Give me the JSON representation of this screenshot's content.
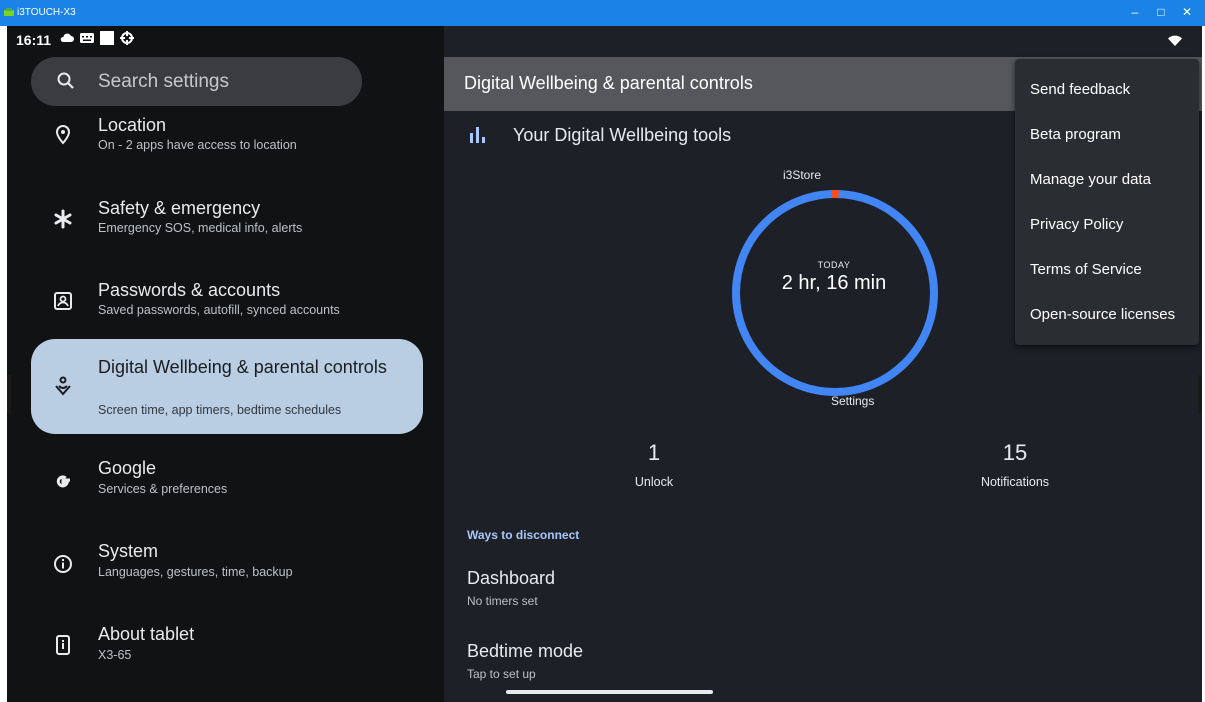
{
  "window": {
    "title": "i3TOUCH-X3",
    "minimize": "–",
    "maximize": "□",
    "close": "✕"
  },
  "status_bar": {
    "time": "16:11",
    "icons": [
      "cloud-icon",
      "keyboard-icon",
      "square-icon",
      "gear-icon"
    ],
    "right_icon": "wifi-icon"
  },
  "search": {
    "placeholder": "Search settings",
    "icon": "search-icon"
  },
  "sidebar": {
    "items": [
      {
        "title": "Location",
        "subtitle": "On - 2 apps have access to location",
        "icon": "location-pin-icon"
      },
      {
        "title": "Safety & emergency",
        "subtitle": "Emergency SOS, medical info, alerts",
        "icon": "asterisk-icon"
      },
      {
        "title": "Passwords & accounts",
        "subtitle": "Saved passwords, autofill, synced accounts",
        "icon": "account-box-icon"
      },
      {
        "title": "Digital Wellbeing & parental controls",
        "subtitle": "Screen time, app timers, bedtime schedules",
        "icon": "wellbeing-icon",
        "selected": true
      },
      {
        "title": "Google",
        "subtitle": "Services & preferences",
        "icon": "google-icon"
      },
      {
        "title": "System",
        "subtitle": "Languages, gestures, time, backup",
        "icon": "info-icon"
      },
      {
        "title": "About tablet",
        "subtitle": "X3-65",
        "icon": "tablet-icon"
      }
    ]
  },
  "main": {
    "header_title": "Digital Wellbeing & parental controls",
    "tools_title": "Your Digital Wellbeing tools",
    "ring": {
      "top_label": "i3Store",
      "bottom_label": "Settings",
      "period": "TODAY",
      "total_time": "2 hr, 16 min",
      "color_main": "#4285f4",
      "color_accent": "#f4511e",
      "accent_fraction": 0.012
    },
    "stats": [
      {
        "value": "1",
        "label": "Unlock"
      },
      {
        "value": "15",
        "label": "Notifications"
      }
    ],
    "section_title": "Ways to disconnect",
    "rows": [
      {
        "title": "Dashboard",
        "subtitle": "No timers set"
      },
      {
        "title": "Bedtime mode",
        "subtitle": "Tap to set up"
      }
    ]
  },
  "overflow_menu": {
    "items": [
      "Send feedback",
      "Beta program",
      "Manage your data",
      "Privacy Policy",
      "Terms of Service",
      "Open-source licenses"
    ]
  },
  "colors": {
    "selected_item_bg": "#b9cde3",
    "section_accent": "#a8c7fa",
    "titlebar": "#1b83e6"
  }
}
